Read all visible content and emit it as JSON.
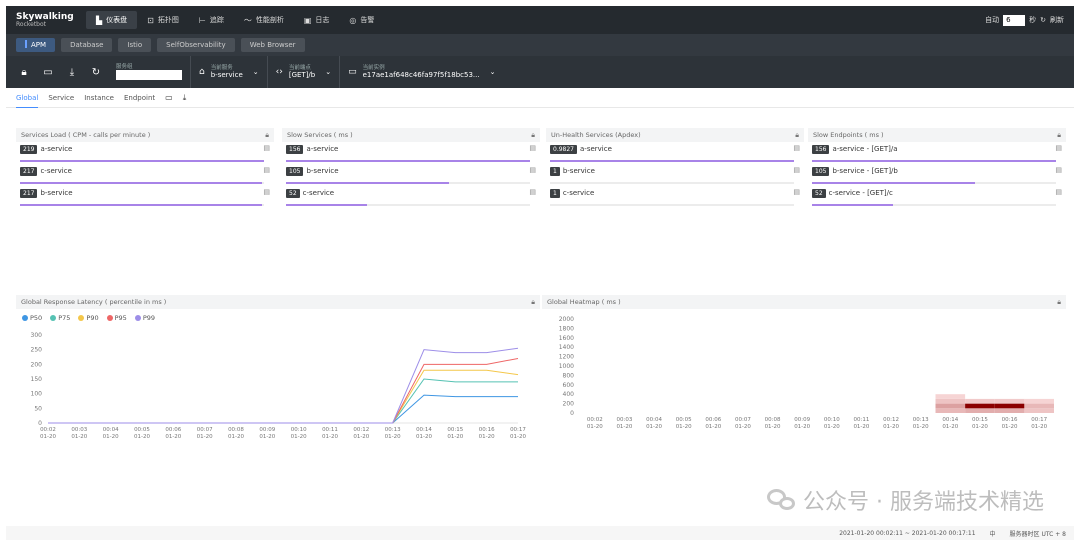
{
  "brand": {
    "line1": "Skywalking",
    "line2": "Rocketbot"
  },
  "nav": {
    "items": [
      {
        "label": "仪表盘",
        "icon": "dashboard-icon",
        "glyph": "▙",
        "active": true
      },
      {
        "label": "拓扑图",
        "icon": "topology-icon",
        "glyph": "⊡",
        "active": false
      },
      {
        "label": "追踪",
        "icon": "trace-icon",
        "glyph": "⊢",
        "active": false
      },
      {
        "label": "性能剖析",
        "icon": "profile-icon",
        "glyph": "〜",
        "active": false
      },
      {
        "label": "日志",
        "icon": "log-icon",
        "glyph": "▣",
        "active": false
      },
      {
        "label": "告警",
        "icon": "alarm-icon",
        "glyph": "◎",
        "active": false
      }
    ],
    "auto_label": "自动",
    "auto_value": "6",
    "seconds_label": "秒",
    "refresh_label": "刷新"
  },
  "subtabs": [
    "APM",
    "Database",
    "Istio",
    "SelfObservability",
    "Web Browser"
  ],
  "toolbar": {
    "service_group_label": "服务组",
    "current_service_label": "当前服务",
    "current_service_value": "b-service",
    "current_endpoint_label": "当前端点",
    "current_endpoint_value": "[GET]/b",
    "current_instance_label": "当前实例",
    "current_instance_value": "e17ae1af648c46fa97f5f18bc53..."
  },
  "pagetabs": [
    "Global",
    "Service",
    "Instance",
    "Endpoint"
  ],
  "panels": {
    "load": {
      "title": "Services Load ( CPM - calls per minute )",
      "rows": [
        {
          "value": "219",
          "name": "a-service",
          "fraction": 1.0
        },
        {
          "value": "217",
          "name": "c-service",
          "fraction": 0.99
        },
        {
          "value": "217",
          "name": "b-service",
          "fraction": 0.99
        }
      ]
    },
    "slow_services": {
      "title": "Slow Services ( ms )",
      "rows": [
        {
          "value": "156",
          "name": "a-service",
          "fraction": 1.0
        },
        {
          "value": "105",
          "name": "b-service",
          "fraction": 0.67
        },
        {
          "value": "52",
          "name": "c-service",
          "fraction": 0.33
        }
      ]
    },
    "unhealth": {
      "title": "Un-Health Services (Apdex)",
      "rows": [
        {
          "value": "0.9827",
          "name": "a-service",
          "fraction": 1.0
        },
        {
          "value": "1",
          "name": "b-service",
          "fraction": 0.0
        },
        {
          "value": "1",
          "name": "c-service",
          "fraction": 0.0
        }
      ]
    },
    "slow_endpoints": {
      "title": "Slow Endpoints ( ms )",
      "rows": [
        {
          "value": "156",
          "name": "a-service - [GET]/a",
          "fraction": 1.0
        },
        {
          "value": "105",
          "name": "b-service - [GET]/b",
          "fraction": 0.67
        },
        {
          "value": "52",
          "name": "c-service - [GET]/c",
          "fraction": 0.33
        }
      ]
    },
    "latency_title": "Global Response Latency ( percentile in ms )",
    "heatmap_title": "Global Heatmap ( ms )"
  },
  "chart_data": [
    {
      "type": "line",
      "title": "Global Response Latency ( percentile in ms )",
      "x": [
        "00:02",
        "00:03",
        "00:04",
        "00:05",
        "00:06",
        "00:07",
        "00:08",
        "00:09",
        "00:10",
        "00:11",
        "00:12",
        "00:13",
        "00:14",
        "00:15",
        "00:16",
        "00:17"
      ],
      "x_sub": "01-20",
      "ylim": [
        0,
        300
      ],
      "yticks": [
        0,
        50,
        100,
        150,
        200,
        250,
        300
      ],
      "grid": false,
      "legend": "top-left",
      "series": [
        {
          "name": "P50",
          "color": "#3f96e3",
          "values": [
            0,
            0,
            0,
            0,
            0,
            0,
            0,
            0,
            0,
            0,
            0,
            0,
            95,
            90,
            90,
            90
          ]
        },
        {
          "name": "P75",
          "color": "#56c2b3",
          "values": [
            0,
            0,
            0,
            0,
            0,
            0,
            0,
            0,
            0,
            0,
            0,
            0,
            150,
            140,
            140,
            140
          ]
        },
        {
          "name": "P90",
          "color": "#f4c74a",
          "values": [
            0,
            0,
            0,
            0,
            0,
            0,
            0,
            0,
            0,
            0,
            0,
            0,
            180,
            180,
            180,
            165
          ]
        },
        {
          "name": "P95",
          "color": "#ee6666",
          "values": [
            0,
            0,
            0,
            0,
            0,
            0,
            0,
            0,
            0,
            0,
            0,
            0,
            200,
            200,
            200,
            220
          ]
        },
        {
          "name": "P99",
          "color": "#9d8ee8",
          "values": [
            0,
            0,
            0,
            0,
            0,
            0,
            0,
            0,
            0,
            0,
            0,
            0,
            250,
            240,
            240,
            255
          ]
        }
      ]
    },
    {
      "type": "heatmap",
      "title": "Global Heatmap ( ms )",
      "x": [
        "00:02",
        "00:03",
        "00:04",
        "00:05",
        "00:06",
        "00:07",
        "00:08",
        "00:09",
        "00:10",
        "00:11",
        "00:12",
        "00:13",
        "00:14",
        "00:15",
        "00:16",
        "00:17"
      ],
      "x_sub": "01-20",
      "ylim": [
        0,
        2000
      ],
      "yticks": [
        0,
        200,
        400,
        600,
        800,
        1000,
        1200,
        1400,
        1600,
        1800,
        2000
      ],
      "bucket_ms": 100,
      "cells": [
        {
          "x": "00:14",
          "y_from": 0,
          "y_to": 100,
          "intensity": 0.2
        },
        {
          "x": "00:14",
          "y_from": 100,
          "y_to": 200,
          "intensity": 0.3
        },
        {
          "x": "00:14",
          "y_from": 200,
          "y_to": 300,
          "intensity": 0.15
        },
        {
          "x": "00:14",
          "y_from": 300,
          "y_to": 400,
          "intensity": 0.08
        },
        {
          "x": "00:15",
          "y_from": 0,
          "y_to": 100,
          "intensity": 0.25
        },
        {
          "x": "00:15",
          "y_from": 100,
          "y_to": 200,
          "intensity": 1.0
        },
        {
          "x": "00:15",
          "y_from": 200,
          "y_to": 300,
          "intensity": 0.12
        },
        {
          "x": "00:16",
          "y_from": 0,
          "y_to": 100,
          "intensity": 0.25
        },
        {
          "x": "00:16",
          "y_from": 100,
          "y_to": 200,
          "intensity": 1.0
        },
        {
          "x": "00:16",
          "y_from": 200,
          "y_to": 300,
          "intensity": 0.12
        },
        {
          "x": "00:17",
          "y_from": 0,
          "y_to": 100,
          "intensity": 0.15
        },
        {
          "x": "00:17",
          "y_from": 100,
          "y_to": 200,
          "intensity": 0.2
        },
        {
          "x": "00:17",
          "y_from": 200,
          "y_to": 300,
          "intensity": 0.08
        }
      ]
    }
  ],
  "footer": {
    "time_range": "2021-01-20 00:02:11 ~ 2021-01-20 00:17:11",
    "lang": "中",
    "timezone": "服务器时区 UTC + 8"
  },
  "watermark": "公众号 · 服务端技术精选",
  "colors": {
    "bar": "#a883e8",
    "accent": "#448dfe",
    "heat": "#8b0000"
  }
}
